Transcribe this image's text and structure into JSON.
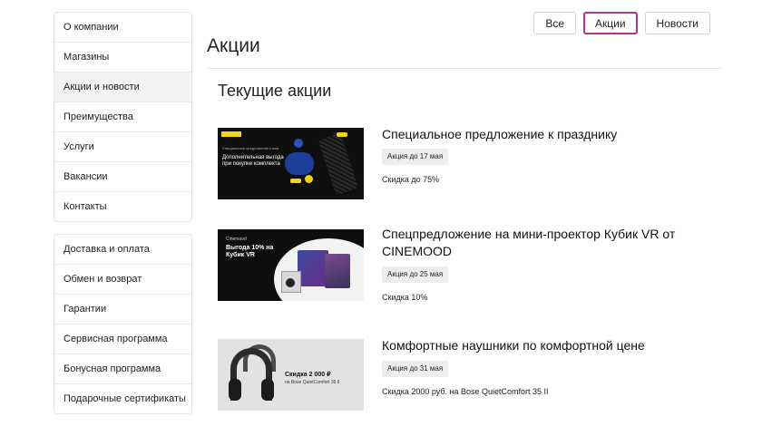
{
  "sidebar": {
    "group1": [
      {
        "label": "О компании"
      },
      {
        "label": "Магазины"
      },
      {
        "label": "Акции и новости"
      },
      {
        "label": "Преимущества"
      },
      {
        "label": "Услуги"
      },
      {
        "label": "Вакансии"
      },
      {
        "label": "Контакты"
      }
    ],
    "group2": [
      {
        "label": "Доставка и оплата"
      },
      {
        "label": "Обмен и возврат"
      },
      {
        "label": "Гарантии"
      },
      {
        "label": "Сервисная программа"
      },
      {
        "label": "Бонусная программа"
      },
      {
        "label": "Подарочные сертификаты"
      }
    ],
    "active": "Акции и новости"
  },
  "filters": [
    {
      "label": "Все"
    },
    {
      "label": "Акции"
    },
    {
      "label": "Новости"
    }
  ],
  "active_filter": "Акции",
  "accent_color": "#b5338a",
  "page_title": "Акции",
  "section_title": "Текущие акции",
  "promos": [
    {
      "title": "Специальное предложение к празднику",
      "badge": "Акция до 17 мая",
      "description": "Скидка до 75%",
      "banner": {
        "small_text": "Специальное предложение к вам",
        "text": "Дополнительная выгода при покупке комплекта"
      }
    },
    {
      "title": "Спецпредложение на мини-проектор Кубик VR от CINEMOOD",
      "badge": "Акция до 25 мая",
      "description": "Скидка 10%",
      "banner": {
        "brand": "Cinemood",
        "text": "Выгода 10% на Кубик VR"
      }
    },
    {
      "title": "Комфортные наушники по комфортной цене",
      "badge": "Акция до 31 мая",
      "description": "Скидка 2000 руб. на Bose QuietComfort 35 II",
      "banner": {
        "text": "Скидка 2 000 ₽",
        "subtext": "на Bose QuietComfort 35 II"
      }
    }
  ]
}
